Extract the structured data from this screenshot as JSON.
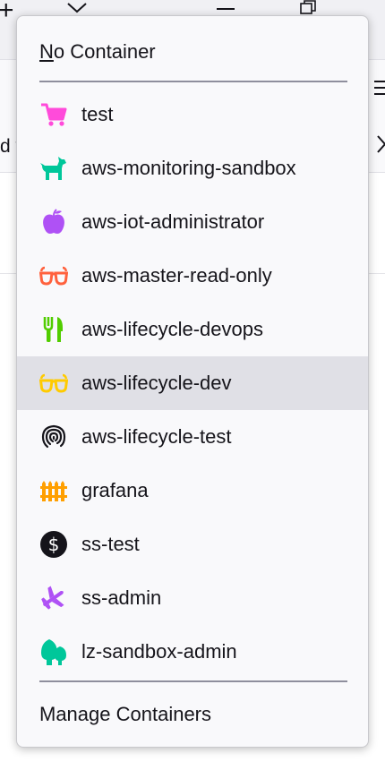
{
  "background": {
    "partial_text": "d v"
  },
  "menu": {
    "no_container": {
      "mnemonic": "N",
      "rest": "o Container"
    },
    "containers": [
      {
        "label": "test",
        "icon": "cart-icon",
        "color": "#ff4bda"
      },
      {
        "label": "aws-monitoring-sandbox",
        "icon": "dog-icon",
        "color": "#00c79a"
      },
      {
        "label": "aws-iot-administrator",
        "icon": "fruit-icon",
        "color": "#af51f5"
      },
      {
        "label": "aws-master-read-only",
        "icon": "glasses-icon",
        "color": "#ff613d"
      },
      {
        "label": "aws-lifecycle-devops",
        "icon": "food-icon",
        "color": "#51cd00"
      },
      {
        "label": "aws-lifecycle-dev",
        "icon": "glasses-icon",
        "color": "#ffcb00"
      },
      {
        "label": "aws-lifecycle-test",
        "icon": "fingerprint-icon",
        "color": "#15141a"
      },
      {
        "label": "grafana",
        "icon": "fence-icon",
        "color": "#ff9f00"
      },
      {
        "label": "ss-test",
        "icon": "dollar-icon",
        "color": "#15141a"
      },
      {
        "label": "ss-admin",
        "icon": "vacation-icon",
        "color": "#af51f5"
      },
      {
        "label": "lz-sandbox-admin",
        "icon": "tree-icon",
        "color": "#00c79a"
      }
    ],
    "selected_label": "aws-lifecycle-dev",
    "manage_label": "Manage Containers"
  }
}
